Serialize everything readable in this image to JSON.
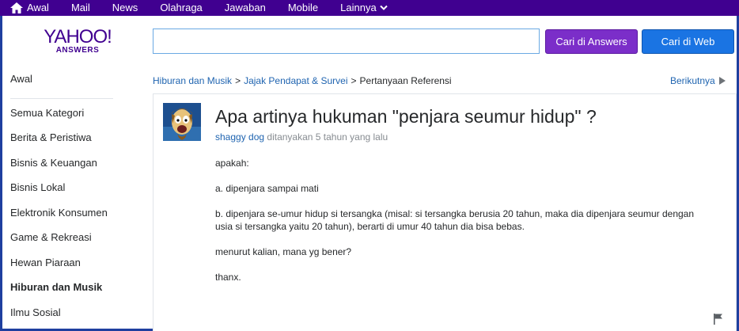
{
  "topnav": {
    "items": [
      {
        "label": "Awal",
        "icon": "home-icon"
      },
      {
        "label": "Mail"
      },
      {
        "label": "News"
      },
      {
        "label": "Olahraga"
      },
      {
        "label": "Jawaban"
      },
      {
        "label": "Mobile"
      },
      {
        "label": "Lainnya",
        "icon": "chevron-down-icon"
      }
    ]
  },
  "logo": {
    "brand": "YAHOO!",
    "sub": "ANSWERS"
  },
  "search": {
    "value": "",
    "button_answers": "Cari di Answers",
    "button_web": "Cari di Web"
  },
  "sidebar": {
    "items": [
      {
        "label": "Awal"
      },
      {
        "label": "Semua Kategori"
      },
      {
        "label": "Berita & Peristiwa"
      },
      {
        "label": "Bisnis & Keuangan"
      },
      {
        "label": "Bisnis Lokal"
      },
      {
        "label": "Elektronik Konsumen"
      },
      {
        "label": "Game & Rekreasi"
      },
      {
        "label": "Hewan Piaraan"
      },
      {
        "label": "Hiburan dan Musik",
        "active": true
      },
      {
        "label": "Ilmu Sosial"
      }
    ]
  },
  "breadcrumb": {
    "items": [
      "Hiburan dan Musik",
      "Jajak Pendapat & Survei",
      "Pertanyaan Referensi"
    ],
    "separator": ">",
    "next": "Berikutnya"
  },
  "question": {
    "title": "Apa artinya hukuman \"penjara seumur hidup\" ?",
    "author": "shaggy dog",
    "asked": "ditanyakan 5 tahun yang lalu",
    "body": [
      "apakah:",
      "a. dipenjara sampai mati",
      "b. dipenjara se-umur hidup si tersangka (misal: si tersangka berusia 20 tahun, maka dia dipenjara seumur dengan usia si tersangka yaitu 20 tahun), berarti di umur 40 tahun dia bisa bebas.",
      "menurut kalian, mana yg bener?",
      "thanx."
    ]
  },
  "colors": {
    "topnav_bg": "#400090",
    "brand_purple": "#400090",
    "answers_button": "#7b2ec9",
    "web_button": "#1a74e3",
    "link_blue": "#1f64b0",
    "meta_gray": "#878c91"
  }
}
